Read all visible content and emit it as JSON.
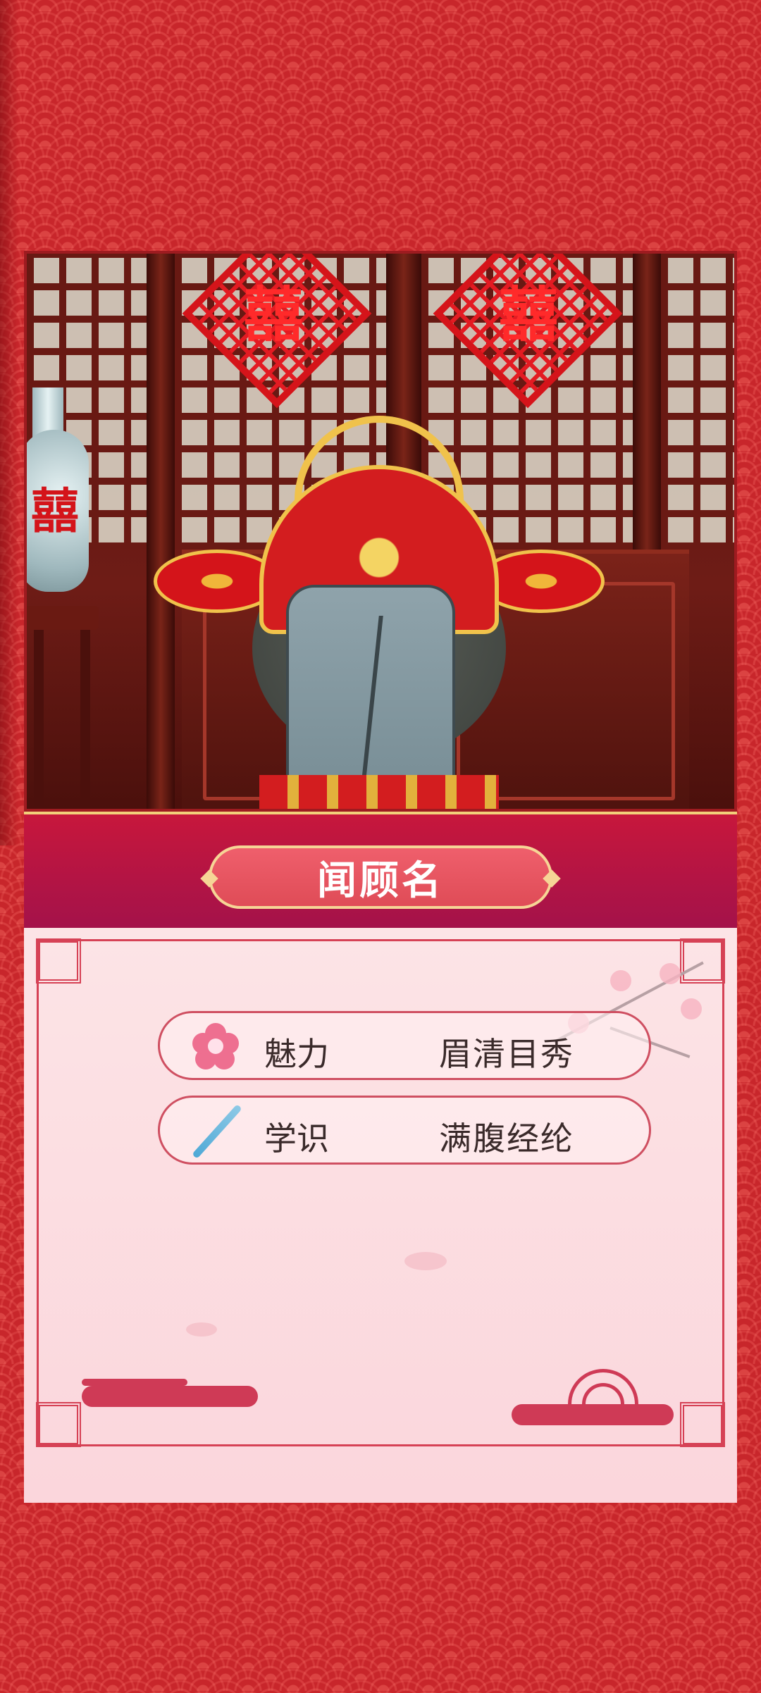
{
  "title_plate": {
    "name": "闻顾名"
  },
  "attributes": [
    {
      "icon": "plum-blossom-icon",
      "label": "魅力",
      "value": "眉清目秀"
    },
    {
      "icon": "brush-icon",
      "label": "学识",
      "value": "满腹经纶"
    }
  ],
  "decorations": {
    "double_happiness": "囍"
  },
  "colors": {
    "background": "#c8262b",
    "band": "#a4124a",
    "plate": "#e25662",
    "card": "#fce4e6",
    "accent_gold": "#f6d596"
  }
}
